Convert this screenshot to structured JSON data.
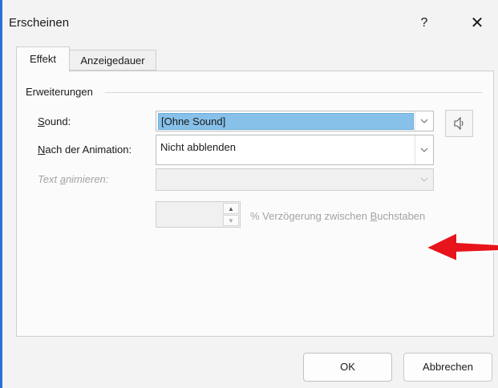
{
  "dialog": {
    "title": "Erscheinen",
    "help_label": "?",
    "close_label": "✕"
  },
  "tabs": [
    {
      "label": "Effekt",
      "active": true
    },
    {
      "label": "Anzeigedauer",
      "active": false
    }
  ],
  "group": {
    "title": "Erweiterungen"
  },
  "sound": {
    "label_mnemonic": "S",
    "label_rest": "ound:",
    "value": "[Ohne Sound]"
  },
  "after_animation": {
    "label_mnemonic": "N",
    "label_rest": "ach der Animation:",
    "value": "Nicht abblenden"
  },
  "animate_text": {
    "label_prefix": "Text ",
    "label_mnemonic": "a",
    "label_rest": "nimieren:",
    "value": ""
  },
  "delay": {
    "value": "",
    "label_prefix": "% Verzögerung zwischen ",
    "label_mnemonic": "B",
    "label_rest": "uchstaben"
  },
  "buttons": {
    "ok": "OK",
    "cancel": "Abbrechen"
  },
  "icons": {
    "speaker": "speaker-icon",
    "dropdown": "chevron-down-icon",
    "annotation": "red-arrow-icon"
  },
  "colors": {
    "selection": "#87c1ea",
    "annotation": "#e8141b"
  }
}
